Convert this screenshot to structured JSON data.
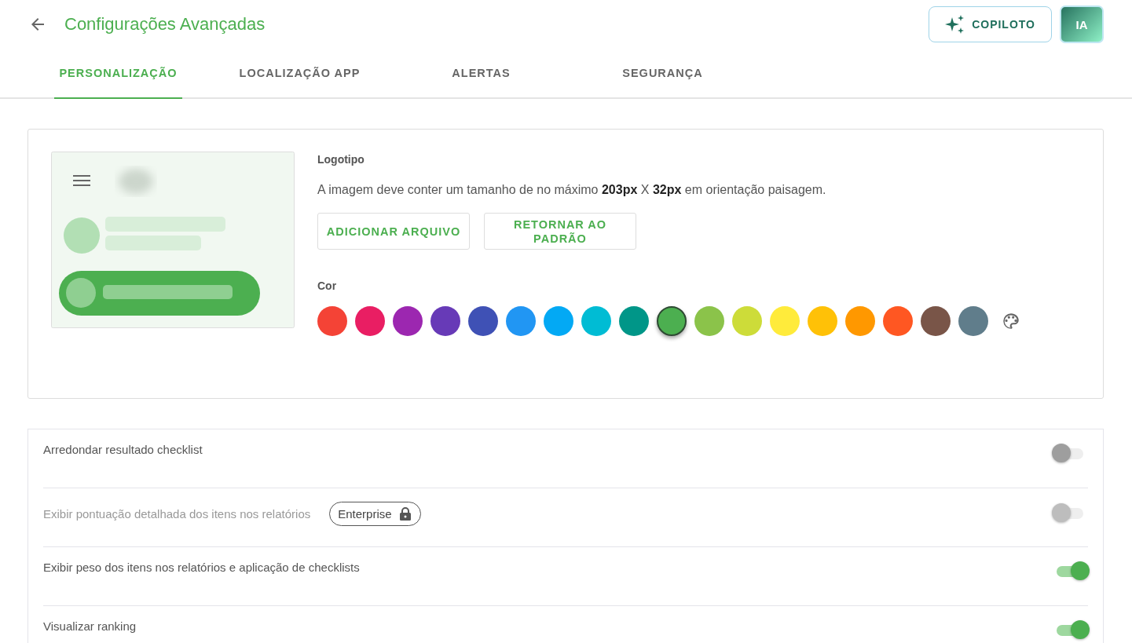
{
  "header": {
    "title": "Configurações Avançadas",
    "copilot_button": "COPILOTO",
    "avatar": "IA"
  },
  "tabs": [
    {
      "label": "PERSONALIZAÇÃO",
      "selected": true
    },
    {
      "label": "LOCALIZAÇÃO APP",
      "selected": false
    },
    {
      "label": "ALERTAS",
      "selected": false
    },
    {
      "label": "SEGURANÇA",
      "selected": false
    }
  ],
  "logo": {
    "title": "Logotipo",
    "description": "A imagem deve conter um tamanho de no máximo **203px** X **32px** em orientação paisagem.",
    "buttons": [
      "ADICIONAR ARQUIVO",
      "RETORNAR AO PADRÃO"
    ]
  },
  "color": {
    "title": "Cor",
    "swatches": [
      {
        "color": "#f44336",
        "selected": false
      },
      {
        "color": "#e91e63",
        "selected": false
      },
      {
        "color": "#9c27b0",
        "selected": false
      },
      {
        "color": "#673ab7",
        "selected": false
      },
      {
        "color": "#3f51b5",
        "selected": false
      },
      {
        "color": "#2196f3",
        "selected": false
      },
      {
        "color": "#03a9f4",
        "selected": false
      },
      {
        "color": "#00bcd4",
        "selected": false
      },
      {
        "color": "#009688",
        "selected": false
      },
      {
        "color": "#4caf50",
        "selected": true
      },
      {
        "color": "#8bc34a",
        "selected": false
      },
      {
        "color": "#cddc39",
        "selected": false
      },
      {
        "color": "#ffeb3b",
        "selected": false
      },
      {
        "color": "#ffc107",
        "selected": false
      },
      {
        "color": "#ff9800",
        "selected": false
      },
      {
        "color": "#ff5722",
        "selected": false
      },
      {
        "color": "#795548",
        "selected": false
      },
      {
        "color": "#607d8b",
        "selected": false
      }
    ]
  },
  "settings": [
    {
      "label": "Arredondar resultado checklist",
      "on": false,
      "disabled": false
    },
    {
      "label": "Exibir pontuação detalhada dos itens nos relatórios",
      "on": false,
      "disabled": true,
      "badge": "Enterprise"
    },
    {
      "label": "Exibir peso dos itens nos relatórios e aplicação de checklists",
      "on": true,
      "disabled": false
    },
    {
      "label": "Visualizar ranking",
      "on": true,
      "disabled": false
    }
  ]
}
